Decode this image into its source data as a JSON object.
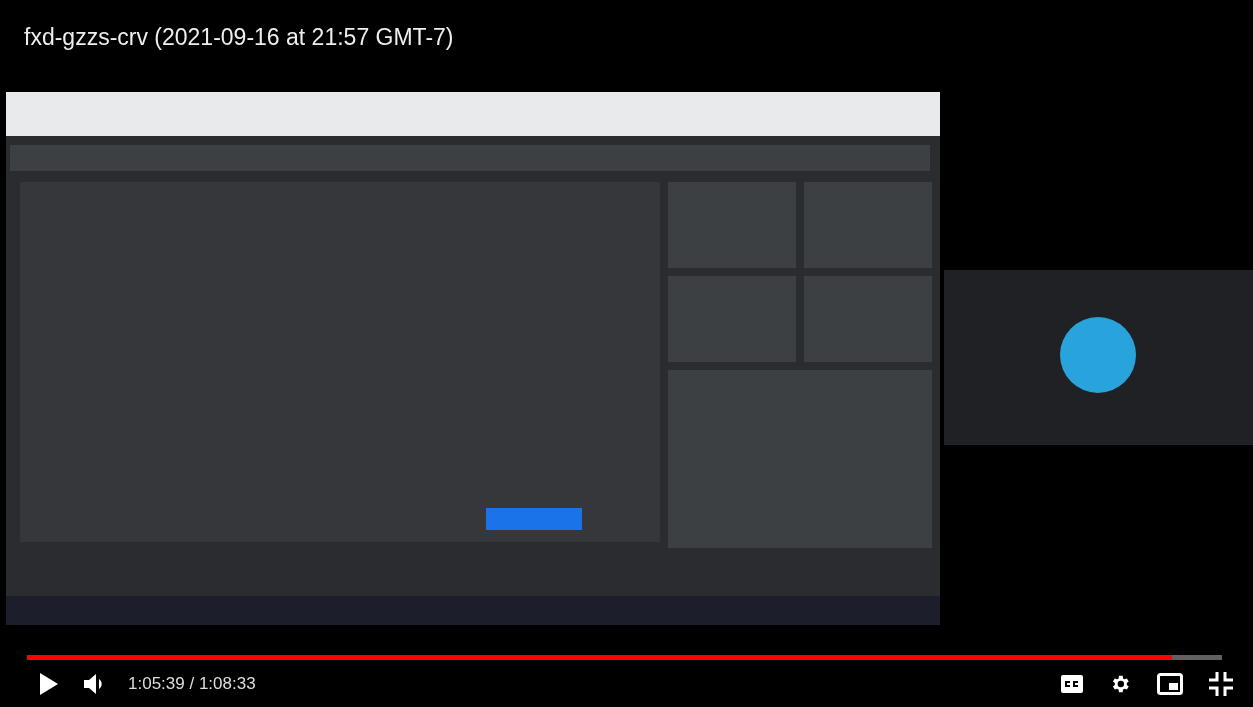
{
  "video": {
    "title": "fxd-gzzs-crv (2021-09-16 at 21:57 GMT-7)",
    "kind": "picture"
  },
  "progress": {
    "level": 0.958
  },
  "controls": {
    "playing": false,
    "time": "1:05:39 / 1:08:33"
  }
}
